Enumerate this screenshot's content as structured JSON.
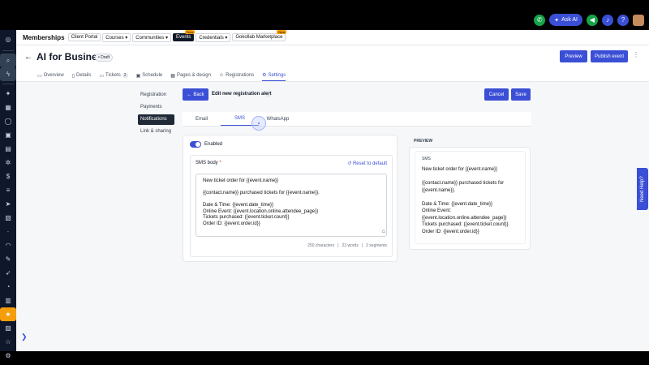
{
  "topbar": {
    "ask_ai_label": "Ask AI",
    "icons": [
      "phone-icon",
      "sparkle-icon",
      "megaphone-icon",
      "bell-icon",
      "help-icon",
      "avatar"
    ]
  },
  "navbar": {
    "brand": "Memberships",
    "items": [
      {
        "label": "Client Portal",
        "badge": ""
      },
      {
        "label": "Courses",
        "badge": ""
      },
      {
        "label": "Communities",
        "badge": ""
      },
      {
        "label": "Events",
        "badge": "New"
      },
      {
        "label": "Credentials",
        "badge": ""
      },
      {
        "label": "Gokollab Marketplace",
        "badge": "New"
      }
    ]
  },
  "header": {
    "title": "AI for Business",
    "status": "Draft",
    "preview_label": "Preview",
    "publish_label": "Publish event",
    "tabs": [
      {
        "label": "Overview",
        "count": ""
      },
      {
        "label": "Details",
        "count": ""
      },
      {
        "label": "Tickets",
        "count": "2"
      },
      {
        "label": "Schedule",
        "count": ""
      },
      {
        "label": "Pages & design",
        "count": ""
      },
      {
        "label": "Registrations",
        "count": ""
      },
      {
        "label": "Settings",
        "count": ""
      }
    ]
  },
  "side_menu": [
    "Registration",
    "Payments",
    "Notifications",
    "Link & sharing"
  ],
  "alert_header": {
    "back_label": "Back",
    "title": "Edit new registration alert",
    "cancel_label": "Cancel",
    "save_label": "Save"
  },
  "channels": [
    "Email",
    "SMS",
    "WhatsApp"
  ],
  "editor": {
    "enabled_label": "Enabled",
    "sms_body_label": "SMS body",
    "required_mark": "*",
    "reset_label": "Reset to default",
    "lines": [
      "New ticket order for {{event.name}}",
      "",
      "{{contact.name}} purchased tickets for {{event.name}}.",
      "",
      "Date & Time: {{event.date_time}}",
      "Online Event: {{event.location.online.attendee_page}}",
      "Tickets purchased: {{event.ticket.count}}",
      "Order ID: {{event.order.id}}"
    ],
    "characters": "250 characters",
    "words": "23 words",
    "segments": "2 segments"
  },
  "preview": {
    "title": "PREVIEW",
    "label": "SMS",
    "lines": [
      "New ticket order for {{event.name}}",
      "",
      "{{contact.name}} purchased tickets for",
      "{{event.name}}.",
      "",
      "Date & Time: {{event.date_time}}",
      "Online Event:",
      "{{event.location.online.attendee_page}}",
      "Tickets purchased: {{event.ticket.count}}",
      "Order ID: {{event.order.id}}"
    ]
  },
  "need_help_label": "Need Help?"
}
